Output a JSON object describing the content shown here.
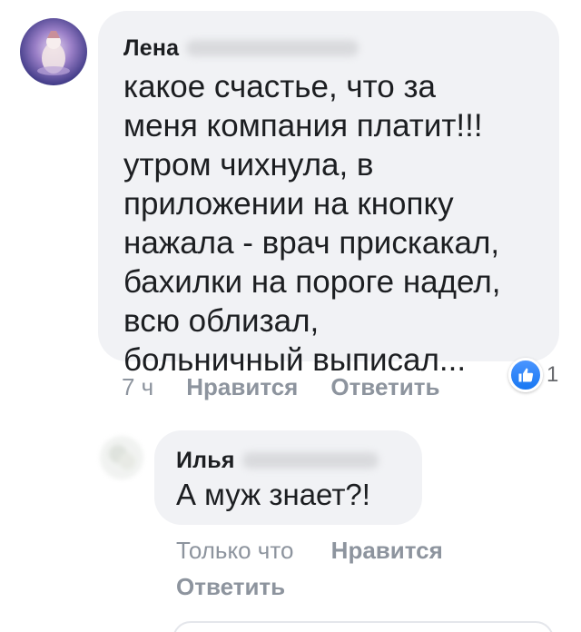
{
  "comment": {
    "author": "Лена",
    "text": "какое счастье, что за\nменя компания платит!!!\nутром чихнула, в\nприложении на кнопку\nнажала - врач прискакал,\nбахилки на пороге надел,\nвсю облизал,\nбольничный выписал...",
    "time": "7 ч",
    "like_label": "Нравится",
    "reply_label": "Ответить",
    "reaction_icon": "like-icon",
    "reaction_count": "1"
  },
  "reply": {
    "author": "Илья",
    "text": "А муж знает?!",
    "time": "Только что",
    "like_label": "Нравится",
    "reply_label": "Ответить"
  },
  "colors": {
    "bubble": "#f1f2f5",
    "meta_text": "#8d949e",
    "like_blue": "#1877f2",
    "body_text": "#1c1e21"
  }
}
